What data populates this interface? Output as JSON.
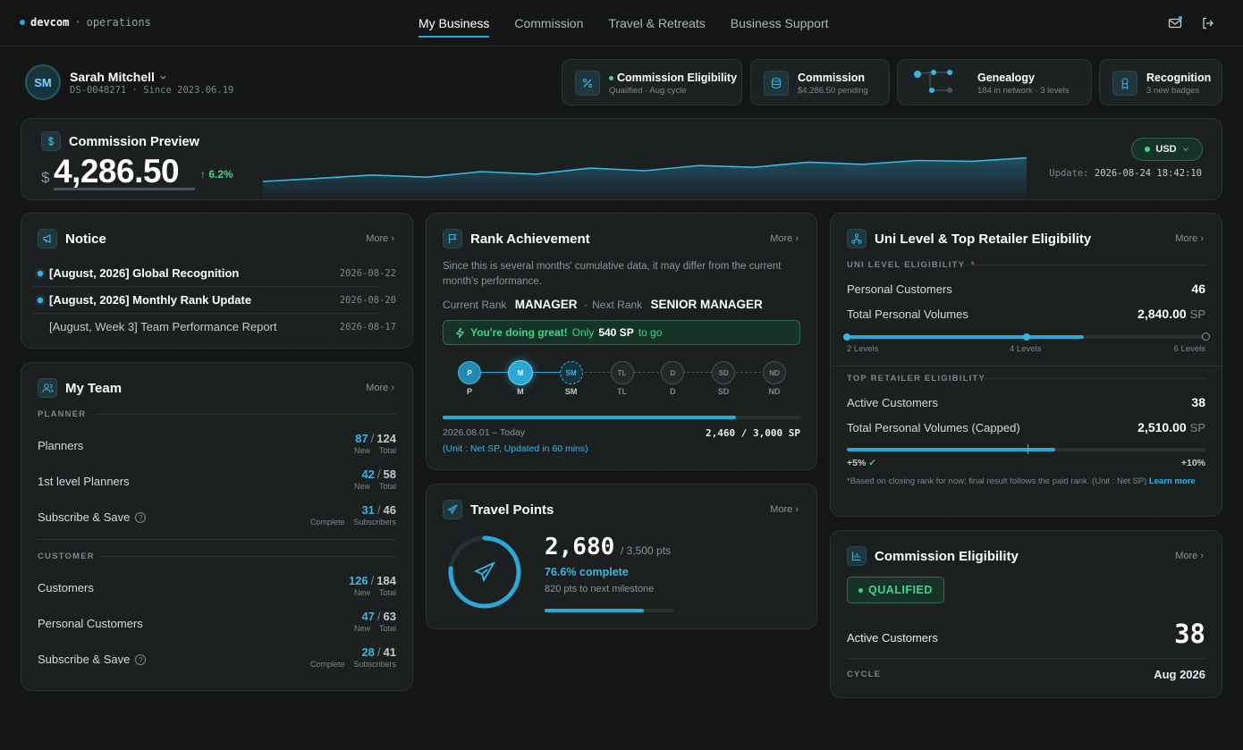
{
  "brand": {
    "name": "devcom",
    "sep": "·",
    "section": "operations"
  },
  "nav": [
    "My Business",
    "Commission",
    "Travel & Retreats",
    "Business Support"
  ],
  "user": {
    "initials": "SM",
    "name": "Sarah Mitchell",
    "id": "DS-0048271",
    "since": "Since 2023.06.19"
  },
  "quick": [
    {
      "title": "Commission Eligibility",
      "sub": "Qualified · Aug cycle"
    },
    {
      "title": "Commission",
      "sub": "$4,286.50 pending"
    },
    {
      "title": "Genealogy",
      "sub": "184 in network · 3 levels"
    },
    {
      "title": "Recognition",
      "sub": "3 new badges"
    }
  ],
  "preview": {
    "title": "Commission Preview",
    "currency_symbol": "$",
    "amount": "4,286.50",
    "change": "6.2%",
    "currency": "USD",
    "update_label": "Update:",
    "update": "2026-08-24 18:42:10",
    "sparkline": [
      0.25,
      0.32,
      0.4,
      0.35,
      0.48,
      0.42,
      0.56,
      0.5,
      0.62,
      0.58,
      0.7,
      0.65,
      0.74,
      0.72,
      0.8
    ]
  },
  "notice": {
    "title": "Notice",
    "more": "More",
    "items": [
      {
        "text": "[August, 2026] Global Recognition",
        "date": "2026-08-22",
        "new": true
      },
      {
        "text": "[August, 2026] Monthly Rank Update",
        "date": "2026-08-20",
        "new": true
      },
      {
        "text": "[August, Week 3] Team Performance Report",
        "date": "2026-08-17",
        "new": false
      }
    ]
  },
  "team": {
    "title": "My Team",
    "more": "More",
    "planner_label": "PLANNER",
    "customer_label": "CUSTOMER",
    "planner": [
      {
        "label": "Planners",
        "a": "87",
        "b": "124",
        "la": "New",
        "lb": "Total",
        "help": false
      },
      {
        "label": "1st level Planners",
        "a": "42",
        "b": "58",
        "la": "New",
        "lb": "Total",
        "help": false
      },
      {
        "label": "Subscribe & Save",
        "a": "31",
        "b": "46",
        "la": "Complete",
        "lb": "Subscribers",
        "help": true
      }
    ],
    "customer": [
      {
        "label": "Customers",
        "a": "126",
        "b": "184",
        "la": "New",
        "lb": "Total",
        "help": false
      },
      {
        "label": "Personal Customers",
        "a": "47",
        "b": "63",
        "la": "New",
        "lb": "Total",
        "help": false
      },
      {
        "label": "Subscribe & Save",
        "a": "28",
        "b": "41",
        "la": "Complete",
        "lb": "Subscribers",
        "help": true
      }
    ]
  },
  "rank": {
    "title": "Rank Achievement",
    "more": "More",
    "note": "Since this is several months' cumulative data, it may differ from the current month's performance.",
    "current_label": "Current Rank",
    "current": "MANAGER",
    "next_label": "Next Rank",
    "next": "SENIOR MANAGER",
    "banner_strong": "You're doing great!",
    "banner_mid": "Only",
    "banner_sp": "540 SP",
    "banner_end": "to go",
    "steps": [
      "P",
      "M",
      "SM",
      "TL",
      "D",
      "SD",
      "ND"
    ],
    "progress": 0.82,
    "period": "2026.08.01 – Today",
    "score": "2,460 / 3,000 SP",
    "unit": "(Unit : Net SP, Updated in 60 mins)"
  },
  "travel": {
    "title": "Travel Points",
    "more": "More",
    "points": "2,680",
    "total": "/ 3,500 pts",
    "pct_text": "76.6% complete",
    "next": "820 pts to next milestone",
    "progress": 0.766
  },
  "uni": {
    "title": "Uni Level & Top Retailer Eligibility",
    "more": "More",
    "uni_label": "UNI LEVEL ELIGIBILITY",
    "star": "*",
    "rows1": [
      {
        "label": "Personal Customers",
        "value": "46",
        "unit": ""
      },
      {
        "label": "Total Personal Volumes",
        "value": "2,840.00",
        "unit": "SP"
      }
    ],
    "levels": [
      "2 Levels",
      "4 Levels",
      "6 Levels"
    ],
    "level_progress": 0.66,
    "top_label": "TOP RETAILER ELIGIBILITY",
    "rows2": [
      {
        "label": "Active Customers",
        "value": "38",
        "unit": ""
      },
      {
        "label": "Total Personal Volumes (Capped)",
        "value": "2,510.00",
        "unit": "SP"
      }
    ],
    "capped_progress": 0.58,
    "left": "+5%",
    "right": "+10%",
    "footnote": "*Based on closing rank for now; final result follows the paid rank. (Unit : Net SP)",
    "learn": "Learn more"
  },
  "elig": {
    "title": "Commission Eligibility",
    "more": "More",
    "status": "QUALIFIED",
    "active_label": "Active Customers",
    "active": "38",
    "cycle_label": "CYCLE",
    "cycle": "Aug 2026"
  }
}
